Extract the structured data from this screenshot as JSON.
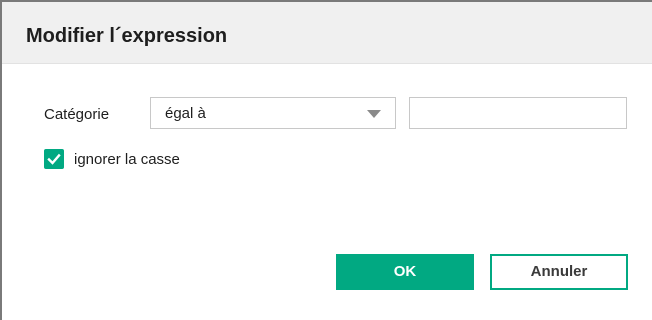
{
  "dialog": {
    "title": "Modifier l´expression"
  },
  "form": {
    "field_label": "Catégorie",
    "operator_select": {
      "selected": "égal à",
      "icon": "chevron-down-icon"
    },
    "value_input": {
      "value": "",
      "placeholder": ""
    },
    "ignore_case": {
      "label": "ignorer la casse",
      "checked": true,
      "icon": "checkmark-icon"
    }
  },
  "buttons": {
    "ok_label": "OK",
    "cancel_label": "Annuler"
  },
  "colors": {
    "accent": "#01a982",
    "header_bg": "#f0f0f0"
  }
}
